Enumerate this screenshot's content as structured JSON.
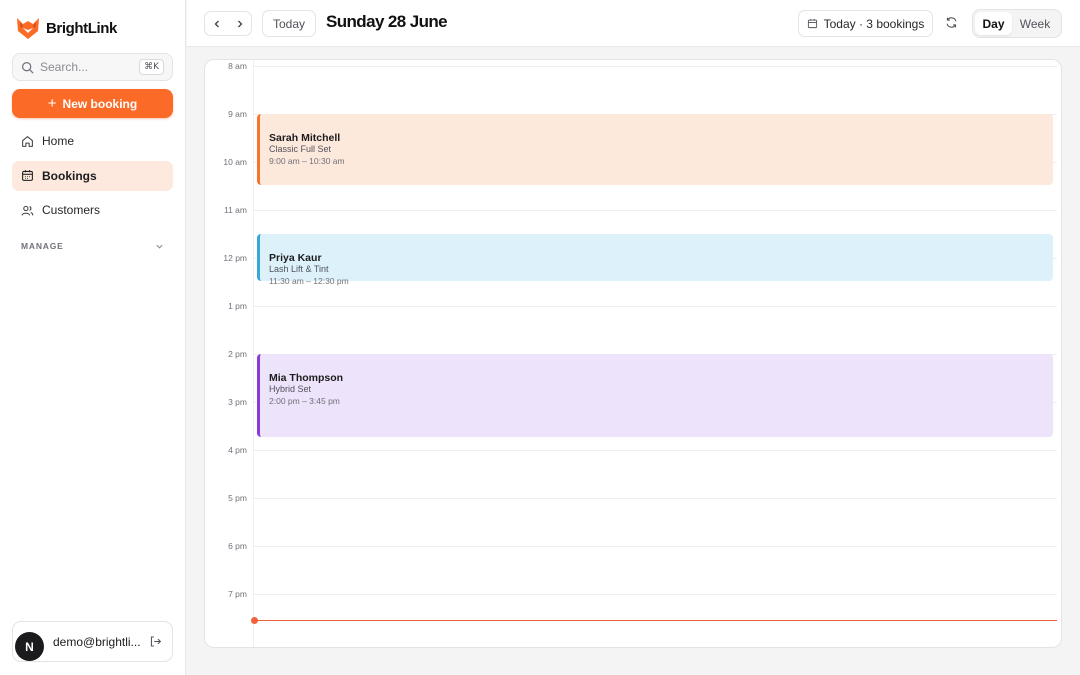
{
  "brand": {
    "name": "BrightLink",
    "accent": "#fb6b27"
  },
  "sidebar": {
    "search": {
      "placeholder": "Search...",
      "shortcut": "⌘K"
    },
    "new_booking": "New booking",
    "items": [
      {
        "label": "Home",
        "icon": "home-icon"
      },
      {
        "label": "Bookings",
        "icon": "calendar-icon",
        "active": true
      },
      {
        "label": "Customers",
        "icon": "users-icon"
      }
    ],
    "section": "MANAGE",
    "user": {
      "initial": "N",
      "email": "demo@brightli..."
    }
  },
  "header": {
    "today_button": "Today",
    "date_title": "Sunday 28 June",
    "summary": "Today · 3 bookings",
    "views": {
      "day": "Day",
      "week": "Week"
    },
    "active_view": "Day"
  },
  "calendar": {
    "hours": [
      "8 am",
      "9 am",
      "10 am",
      "11 am",
      "12 pm",
      "1 pm",
      "2 pm",
      "3 pm",
      "4 pm",
      "5 pm",
      "6 pm",
      "7 pm"
    ],
    "events": [
      {
        "name": "Sarah Mitchell",
        "service": "Classic Full Set",
        "time": "9:00 am – 10:30 am",
        "color": "#fde8dc",
        "border": "#f5742f"
      },
      {
        "name": "Priya Kaur",
        "service": "Lash Lift & Tint",
        "time": "11:30 am – 12:30 pm",
        "color": "#ddf1fb",
        "border": "#3aa6d8"
      },
      {
        "name": "Mia Thompson",
        "service": "Hybrid Set",
        "time": "2:00 pm – 3:45 pm",
        "color": "#ede3fb",
        "border": "#8a3ad6"
      }
    ]
  }
}
